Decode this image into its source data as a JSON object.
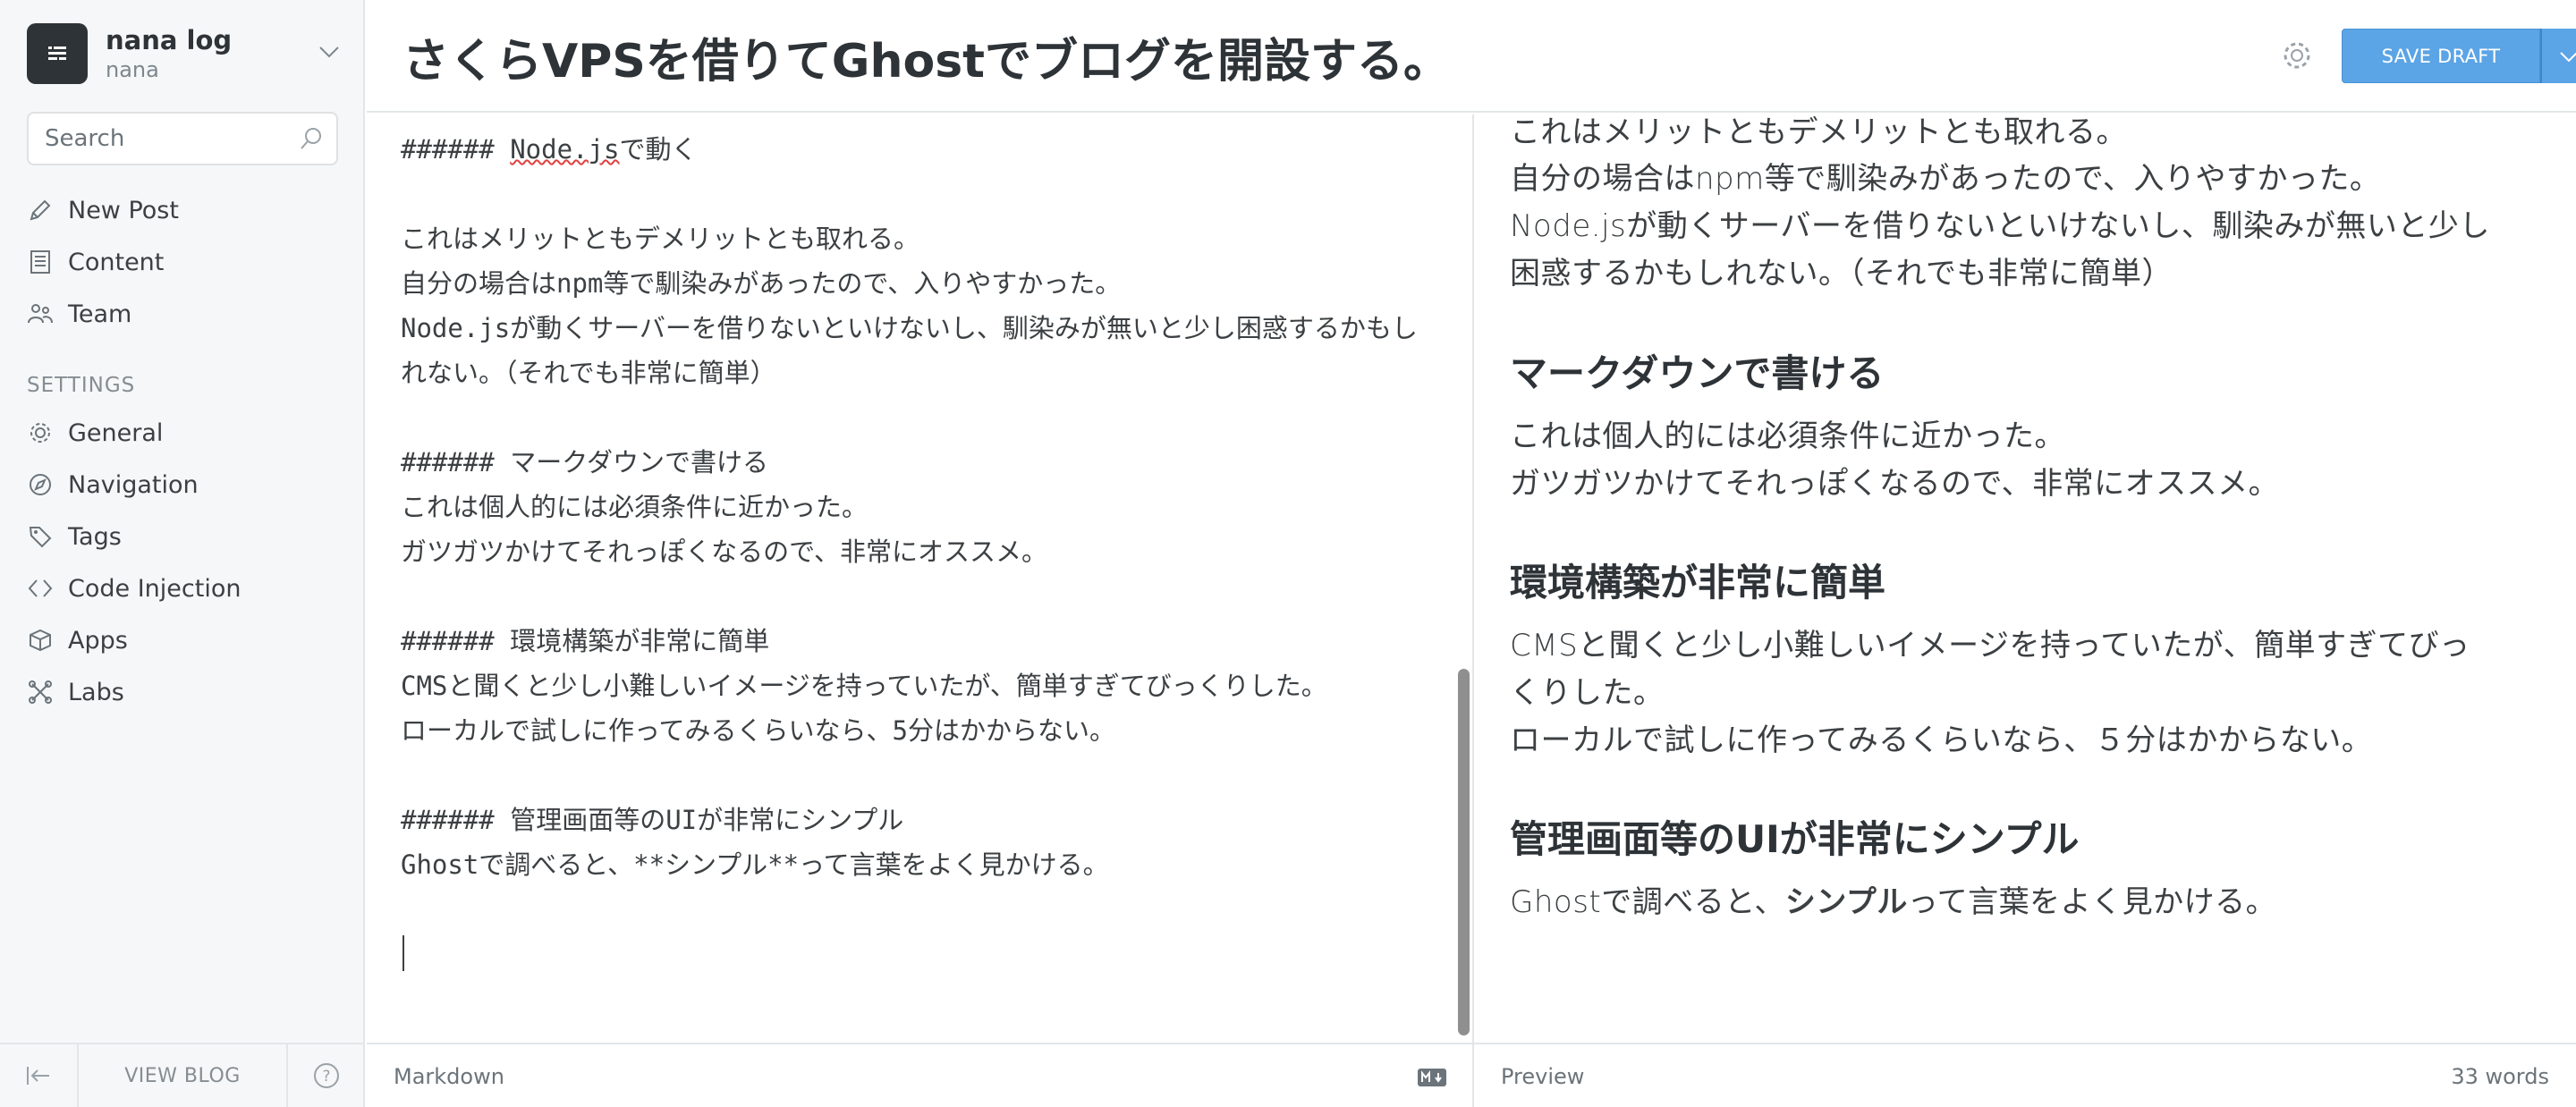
{
  "sidebar": {
    "blog_title": "nana log",
    "blog_user": "nana",
    "search_placeholder": "Search",
    "nav": [
      {
        "label": "New Post",
        "icon": "pencil-icon"
      },
      {
        "label": "Content",
        "icon": "content-icon"
      },
      {
        "label": "Team",
        "icon": "team-icon"
      }
    ],
    "settings_heading": "SETTINGS",
    "settings": [
      {
        "label": "General",
        "icon": "gear-icon"
      },
      {
        "label": "Navigation",
        "icon": "compass-icon"
      },
      {
        "label": "Tags",
        "icon": "tag-icon"
      },
      {
        "label": "Code Injection",
        "icon": "code-icon"
      },
      {
        "label": "Apps",
        "icon": "box-icon"
      },
      {
        "label": "Labs",
        "icon": "labs-icon"
      }
    ],
    "footer": {
      "view_blog": "VIEW BLOG",
      "help": "?"
    }
  },
  "header": {
    "title": "さくらVPSを借りてGhostでブログを開設する。",
    "save_label": "SAVE DRAFT"
  },
  "editor": {
    "lines": [
      "###### Node.jsで動く",
      "",
      "これはメリットともデメリットとも取れる。",
      "自分の場合はnpm等で馴染みがあったので、入りやすかった。",
      "Node.jsが動くサーバーを借りないといけないし、馴染みが無いと少し困惑するかもし",
      "れない。（それでも非常に簡単）",
      "",
      "###### マークダウンで書ける",
      "これは個人的には必須条件に近かった。",
      "ガツガツかけてそれっぽくなるので、非常にオススメ。",
      "",
      "###### 環境構築が非常に簡単",
      "CMSと聞くと少し小難しいイメージを持っていたが、簡単すぎてびっくりした。",
      "ローカルで試しに作ってみるくらいなら、5分はかからない。",
      "",
      "###### 管理画面等のUIが非常にシンプル",
      "Ghostで調べると、**シンプル**って言葉をよく見かける。"
    ],
    "footer_label": "Markdown"
  },
  "preview": {
    "intro_lines": [
      "これはメリットともデメリットとも取れる。",
      "自分の場合はnpm等で馴染みがあったので、入りやすかった。",
      "Node.jsが動くサーバーを借りないといけないし、馴染みが無いと少し",
      "困惑するかもしれない。（それでも非常に簡単）"
    ],
    "sections": [
      {
        "heading": "マークダウンで書ける",
        "lines": [
          "これは個人的には必須条件に近かった。",
          "ガツガツかけてそれっぽくなるので、非常にオススメ。"
        ]
      },
      {
        "heading": "環境構築が非常に簡単",
        "lines": [
          "CMSと聞くと少し小難しいイメージを持っていたが、簡単すぎてびっ",
          "くりした。",
          "ローカルで試しに作ってみるくらいなら、５分はかからない。"
        ]
      },
      {
        "heading": "管理画面等のUIが非常にシンプル",
        "last_before": "Ghostで調べると、",
        "last_bold": "シンプル",
        "last_after": "って言葉をよく見かける。"
      }
    ],
    "footer_label": "Preview",
    "word_count": "33 words"
  },
  "colors": {
    "accent": "#5ba4e5",
    "sidebar_bg": "#f6f7f8",
    "spellcheck": "#e0403f"
  }
}
